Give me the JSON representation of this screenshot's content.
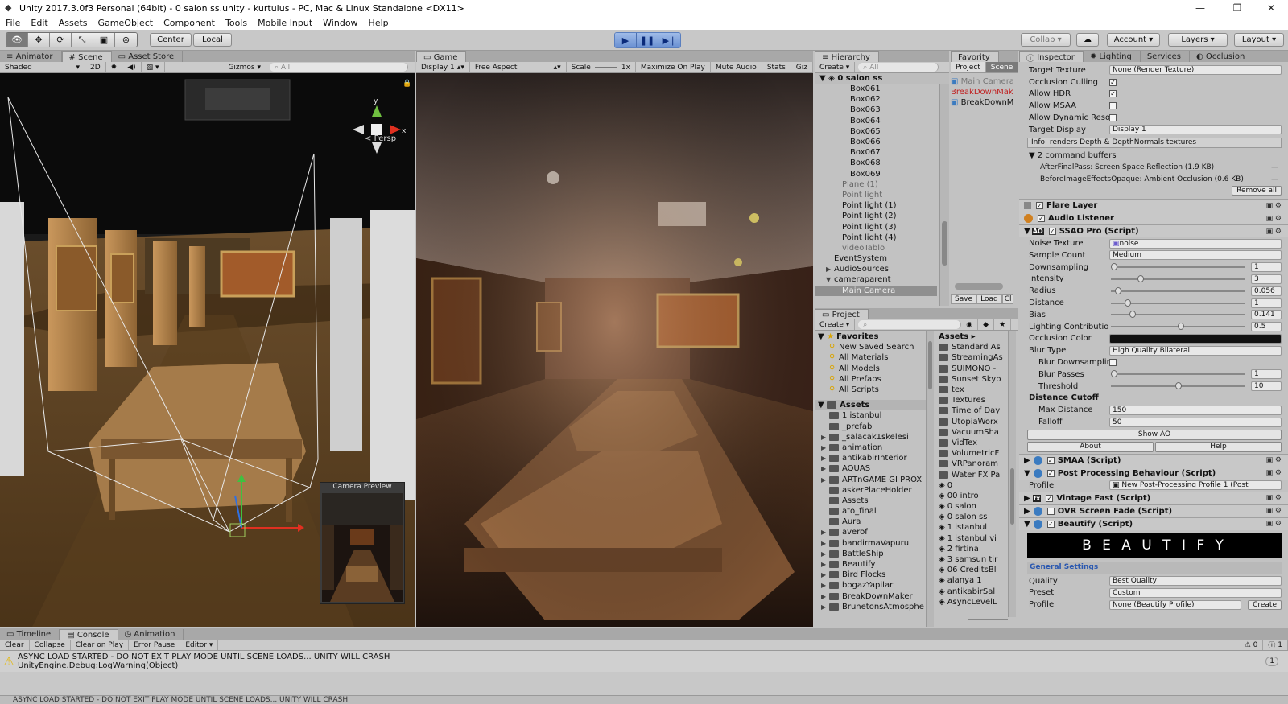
{
  "window": {
    "title": "Unity 2017.3.0f3 Personal (64bit) - 0 salon ss.unity - kurtulus - PC, Mac & Linux Standalone <DX11>"
  },
  "menu": [
    "File",
    "Edit",
    "Assets",
    "GameObject",
    "Component",
    "Tools",
    "Mobile Input",
    "Window",
    "Help"
  ],
  "toolbar": {
    "pivot": "Center",
    "space": "Local",
    "collab": "Collab",
    "account": "Account",
    "layers": "Layers",
    "layout": "Layout"
  },
  "scene_panel": {
    "tabs": [
      "Animator",
      "Scene",
      "Asset Store"
    ],
    "shading": "Shaded",
    "mode_2d": "2D",
    "gizmos": "Gizmos",
    "search_placeholder": "All",
    "persp": "Persp",
    "camera_preview_label": "Camera Preview"
  },
  "game_panel": {
    "tab": "Game",
    "display": "Display 1",
    "aspect": "Free Aspect",
    "scale_label": "Scale",
    "scale_value": "1x",
    "buttons": [
      "Maximize On Play",
      "Mute Audio",
      "Stats",
      "Giz"
    ]
  },
  "hierarchy": {
    "tab": "Hierarchy",
    "create": "Create",
    "search_placeholder": "All",
    "scene_name": "0 salon ss",
    "rows": [
      {
        "label": "Box061",
        "indent": 4,
        "dim": false
      },
      {
        "label": "Box062",
        "indent": 4,
        "dim": false
      },
      {
        "label": "Box063",
        "indent": 4,
        "dim": false
      },
      {
        "label": "Box064",
        "indent": 4,
        "dim": false
      },
      {
        "label": "Box065",
        "indent": 4,
        "dim": false
      },
      {
        "label": "Box066",
        "indent": 4,
        "dim": false
      },
      {
        "label": "Box067",
        "indent": 4,
        "dim": false
      },
      {
        "label": "Box068",
        "indent": 4,
        "dim": false
      },
      {
        "label": "Box069",
        "indent": 4,
        "dim": false
      },
      {
        "label": "Plane (1)",
        "indent": 3,
        "dim": true
      },
      {
        "label": "Point light",
        "indent": 3,
        "dim": true
      },
      {
        "label": "Point light (1)",
        "indent": 3,
        "dim": false
      },
      {
        "label": "Point light (2)",
        "indent": 3,
        "dim": false
      },
      {
        "label": "Point light (3)",
        "indent": 3,
        "dim": false
      },
      {
        "label": "Point light (4)",
        "indent": 3,
        "dim": false
      },
      {
        "label": "videoTablo",
        "indent": 3,
        "dim": true
      },
      {
        "label": "EventSystem",
        "indent": 2,
        "dim": false
      },
      {
        "label": "AudioSources",
        "indent": 2,
        "dim": false,
        "fold": "▶"
      },
      {
        "label": "cameraparent",
        "indent": 2,
        "dim": false,
        "fold": "▼"
      },
      {
        "label": "Main Camera",
        "indent": 3,
        "dim": false,
        "selected": true
      }
    ]
  },
  "favority": {
    "tab": "Favority",
    "subtabs": [
      "Project",
      "Scene"
    ],
    "items": [
      "Main Camera",
      "BreakDownMak",
      "BreakDownM"
    ],
    "buttons": [
      "Save",
      "Load",
      "Cl"
    ]
  },
  "project": {
    "tab": "Project",
    "create": "Create",
    "favorites_label": "Favorites",
    "favorites": [
      "New Saved Search",
      "All Materials",
      "All Models",
      "All Prefabs",
      "All Scripts"
    ],
    "assets_label": "Assets",
    "folders": [
      "1 istanbul",
      "_prefab",
      "_salacak1skelesi",
      "animation",
      "antikabirInterior",
      "AQUAS",
      "ARTnGAME GI PROX",
      "askerPlaceHolder",
      "Assets",
      "ato_final",
      "Aura",
      "averof",
      "bandirmaVapuru",
      "BattleShip",
      "Beautify",
      "Bird Flocks",
      "bogazYapilar",
      "BreakDownMaker",
      "BrunetonsAtmosphe"
    ],
    "right_header": "Assets ▸",
    "right_items": [
      "Standard As",
      "StreamingAs",
      "SUIMONO -",
      "Sunset Skyb",
      "tex",
      "Textures",
      "Time of Day",
      "UtopiaWorx",
      "VacuumSha",
      "VidTex",
      "VolumetricF",
      "VRPanoram",
      "Water FX Pa",
      "0",
      "00 intro",
      "0 salon",
      "0 salon ss",
      "1 istanbul",
      "1 istanbul vi",
      "2 firtina",
      "3 samsun tir",
      "06 CreditsBl",
      "alanya 1",
      "antikabirSal",
      "AsyncLevelL"
    ]
  },
  "inspector": {
    "tabs": [
      "Inspector",
      "Lighting",
      "Services",
      "Occlusion"
    ],
    "top_rows": [
      {
        "label": "Target Texture",
        "value": "None (Render Texture)"
      },
      {
        "label": "Occlusion Culling",
        "check": true
      },
      {
        "label": "Allow HDR",
        "check": true
      },
      {
        "label": "Allow MSAA",
        "check": false
      },
      {
        "label": "Allow Dynamic Resolutio",
        "check": false
      },
      {
        "label": "Target Display",
        "value": "Display 1"
      }
    ],
    "info": "Info: renders Depth & DepthNormals textures",
    "buffers_label": "2 command buffers",
    "buffers": [
      {
        "name": "AfterFinalPass: Screen Space Reflection (1.9 KB)"
      },
      {
        "name": "BeforeImageEffectsOpaque: Ambient Occlusion (0.6 KB)"
      }
    ],
    "remove_all": "Remove all",
    "components_a": [
      "Flare Layer",
      "Audio Listener",
      "SSAO Pro (Script)"
    ],
    "ssao": [
      {
        "label": "Noise Texture",
        "value": "noise"
      },
      {
        "label": "Sample Count",
        "value": "Medium"
      },
      {
        "label": "Downsampling",
        "num": "1",
        "pos": 0.0
      },
      {
        "label": "Intensity",
        "num": "3",
        "pos": 0.2
      },
      {
        "label": "Radius",
        "num": "0.056",
        "pos": 0.03
      },
      {
        "label": "Distance",
        "num": "1",
        "pos": 0.1
      },
      {
        "label": "Bias",
        "num": "0.141",
        "pos": 0.14
      },
      {
        "label": "Lighting Contribution",
        "num": "0.5",
        "pos": 0.5
      },
      {
        "label": "Occlusion Color",
        "color": "#111111"
      },
      {
        "label": "Blur Type",
        "value": "High Quality Bilateral"
      },
      {
        "label": "Blur Downsampling",
        "check": false,
        "sub": true
      },
      {
        "label": "Blur Passes",
        "num": "1",
        "pos": 0.0,
        "sub": true
      },
      {
        "label": "Threshold",
        "num": "10",
        "pos": 0.48,
        "sub": true
      }
    ],
    "distance_cutoff": "Distance Cutoff",
    "cutoff_rows": [
      {
        "label": "Max Distance",
        "value": "150"
      },
      {
        "label": "Falloff",
        "value": "50"
      }
    ],
    "show_ao": "Show AO",
    "about": "About",
    "help": "Help",
    "components_b": [
      {
        "name": "SMAA (Script)",
        "check": true
      },
      {
        "name": "Post Processing Behaviour (Script)",
        "check": true
      }
    ],
    "profile_label": "Profile",
    "profile_value": "New Post-Processing Profile 1 (Post",
    "components_c": [
      {
        "name": "Vintage Fast (Script)",
        "check": true
      },
      {
        "name": "OVR Screen Fade (Script)",
        "check": false
      },
      {
        "name": "Beautify (Script)",
        "check": true
      }
    ],
    "beautify_banner": "B E A U T I F Y",
    "general_settings": "General Settings",
    "beautify_rows": [
      {
        "label": "Quality",
        "value": "Best Quality"
      },
      {
        "label": "Preset",
        "value": "Custom"
      },
      {
        "label": "Profile",
        "value": "None (Beautify Profile)"
      }
    ],
    "create": "Create"
  },
  "bottom": {
    "tabs": [
      "Timeline",
      "Console",
      "Animation"
    ],
    "buttons": [
      "Clear",
      "Collapse",
      "Clear on Play",
      "Error Pause",
      "Editor"
    ],
    "message_line1": "ASYNC LOAD STARTED - DO NOT EXIT PLAY MODE UNTIL SCENE LOADS... UNITY WILL CRASH",
    "message_line2": "UnityEngine.Debug:LogWarning(Object)",
    "count_warn": "0",
    "count_error": "1",
    "count_badge": "1",
    "status": "ASYNC LOAD STARTED - DO NOT EXIT PLAY MODE UNTIL SCENE LOADS... UNITY WILL CRASH"
  },
  "colors": {
    "accent_blue": "#3d6fd0",
    "play_blue": "#7b9fe0",
    "panel_bg": "#c2c2c2",
    "warning": "#e6b800"
  }
}
